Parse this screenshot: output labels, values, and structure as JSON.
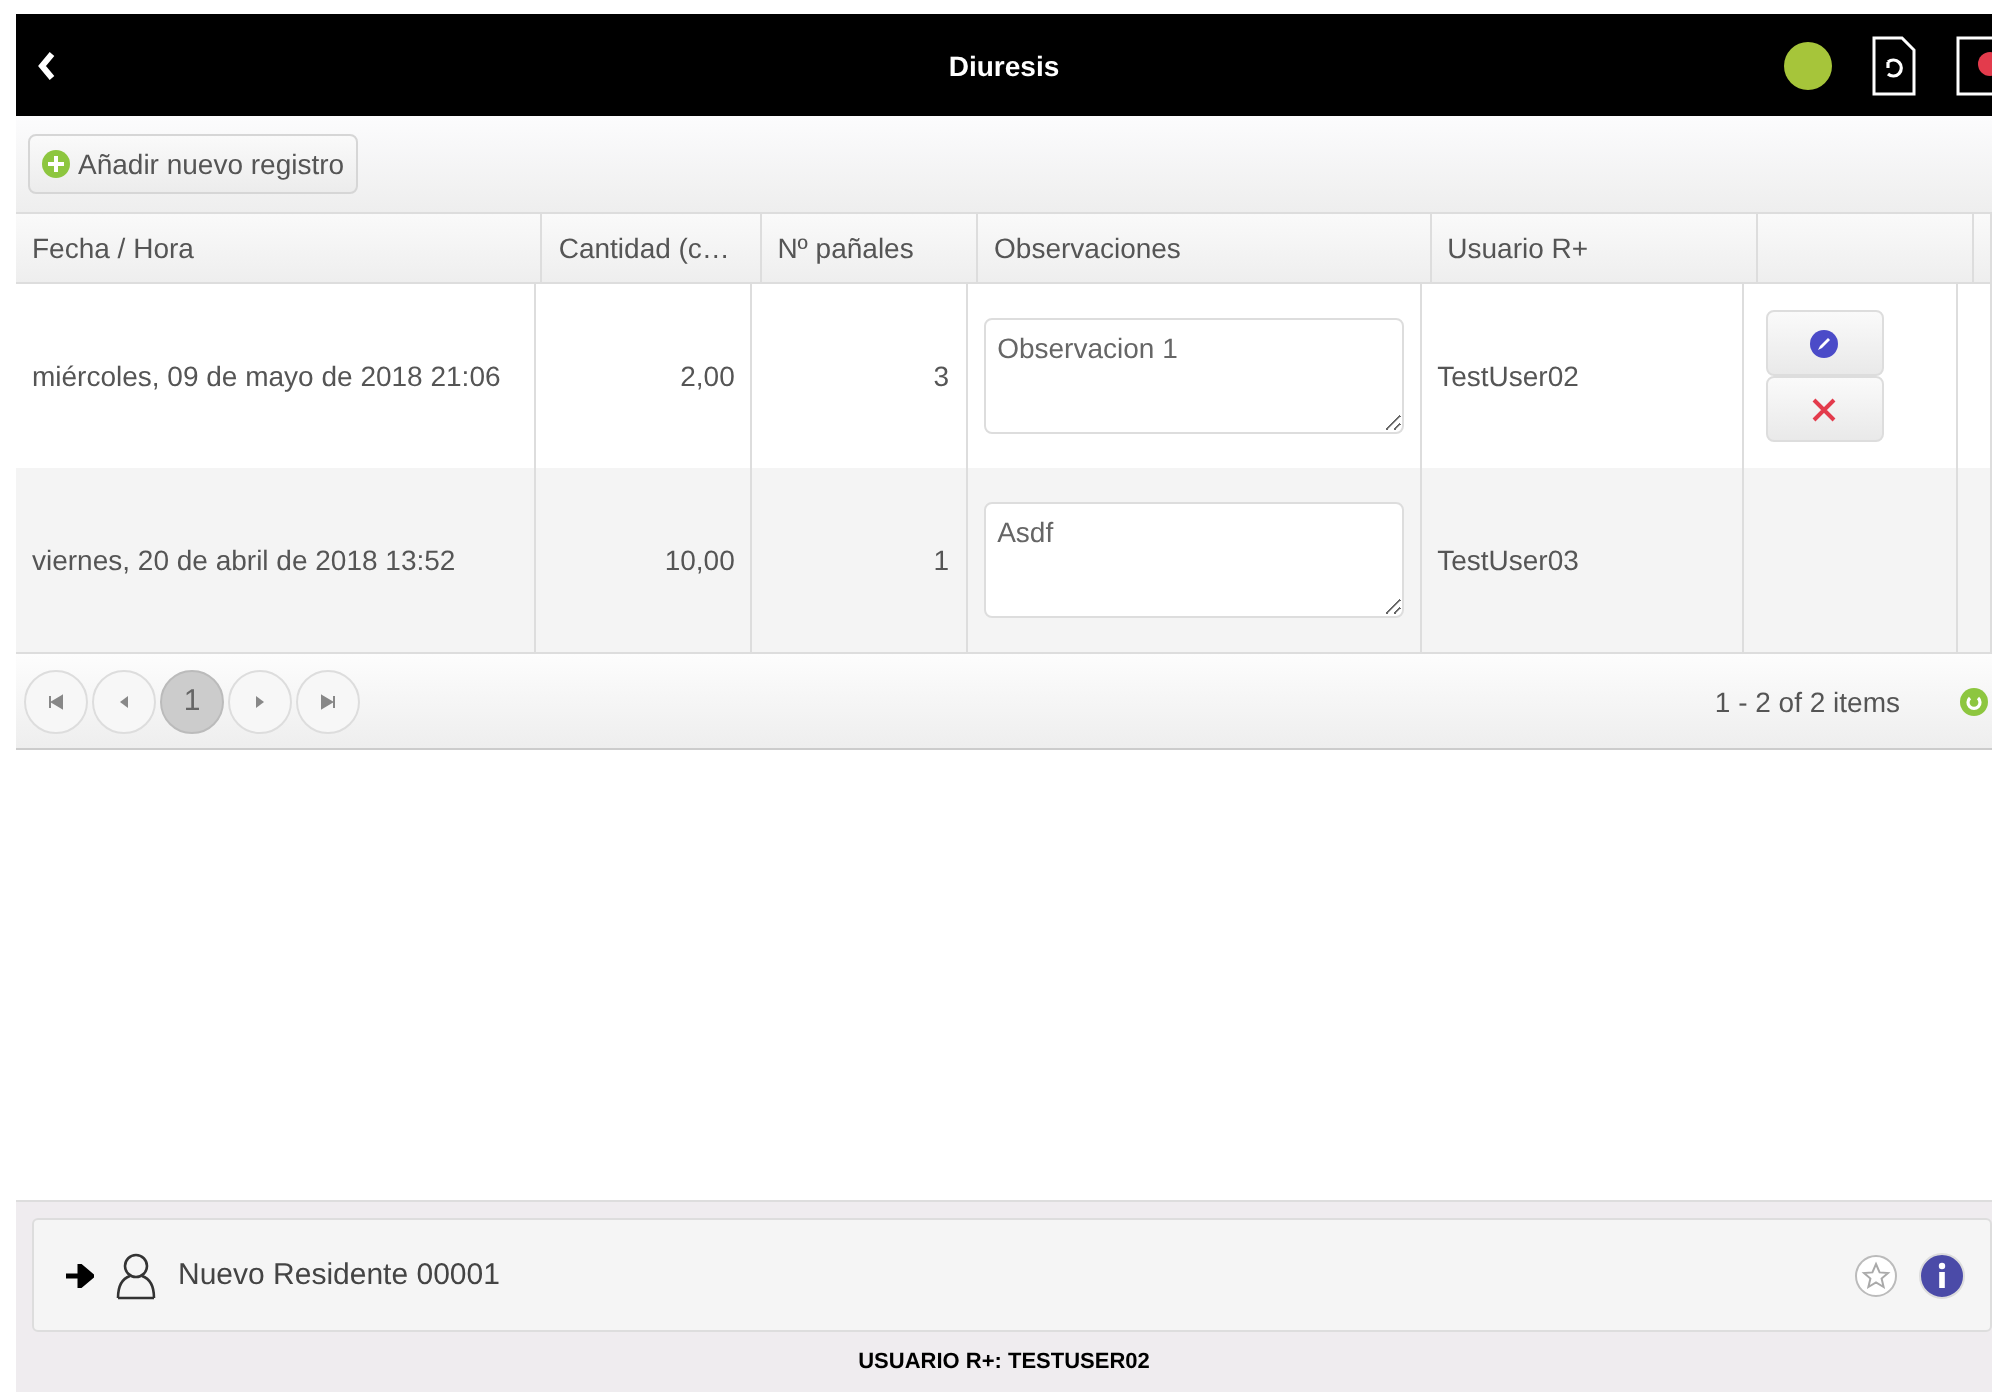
{
  "header": {
    "title": "Diuresis"
  },
  "toolbar": {
    "add_button": "Añadir nuevo registro"
  },
  "table": {
    "columns": [
      "Fecha / Hora",
      "Cantidad (c…",
      "Nº pañales",
      "Observaciones",
      "Usuario R+"
    ],
    "rows": [
      {
        "date": "miércoles, 09 de mayo de 2018 21:06",
        "amount": "2,00",
        "diapers": "3",
        "notes": "Observacion 1",
        "user": "TestUser02",
        "actions": [
          {
            "kind": "edit"
          },
          {
            "kind": "delete"
          }
        ]
      },
      {
        "date": "viernes, 20 de abril de 2018 13:52",
        "amount": "10,00",
        "diapers": "1",
        "notes": "Asdf",
        "user": "TestUser03"
      }
    ]
  },
  "pager": {
    "pages": [
      {
        "label": "1",
        "selected": true
      }
    ],
    "summary": "1 - 2 of 2 items"
  },
  "resident": {
    "name": "Nuevo Residente 00001"
  },
  "status_bar": "USUARIO R+: TESTUSER02"
}
